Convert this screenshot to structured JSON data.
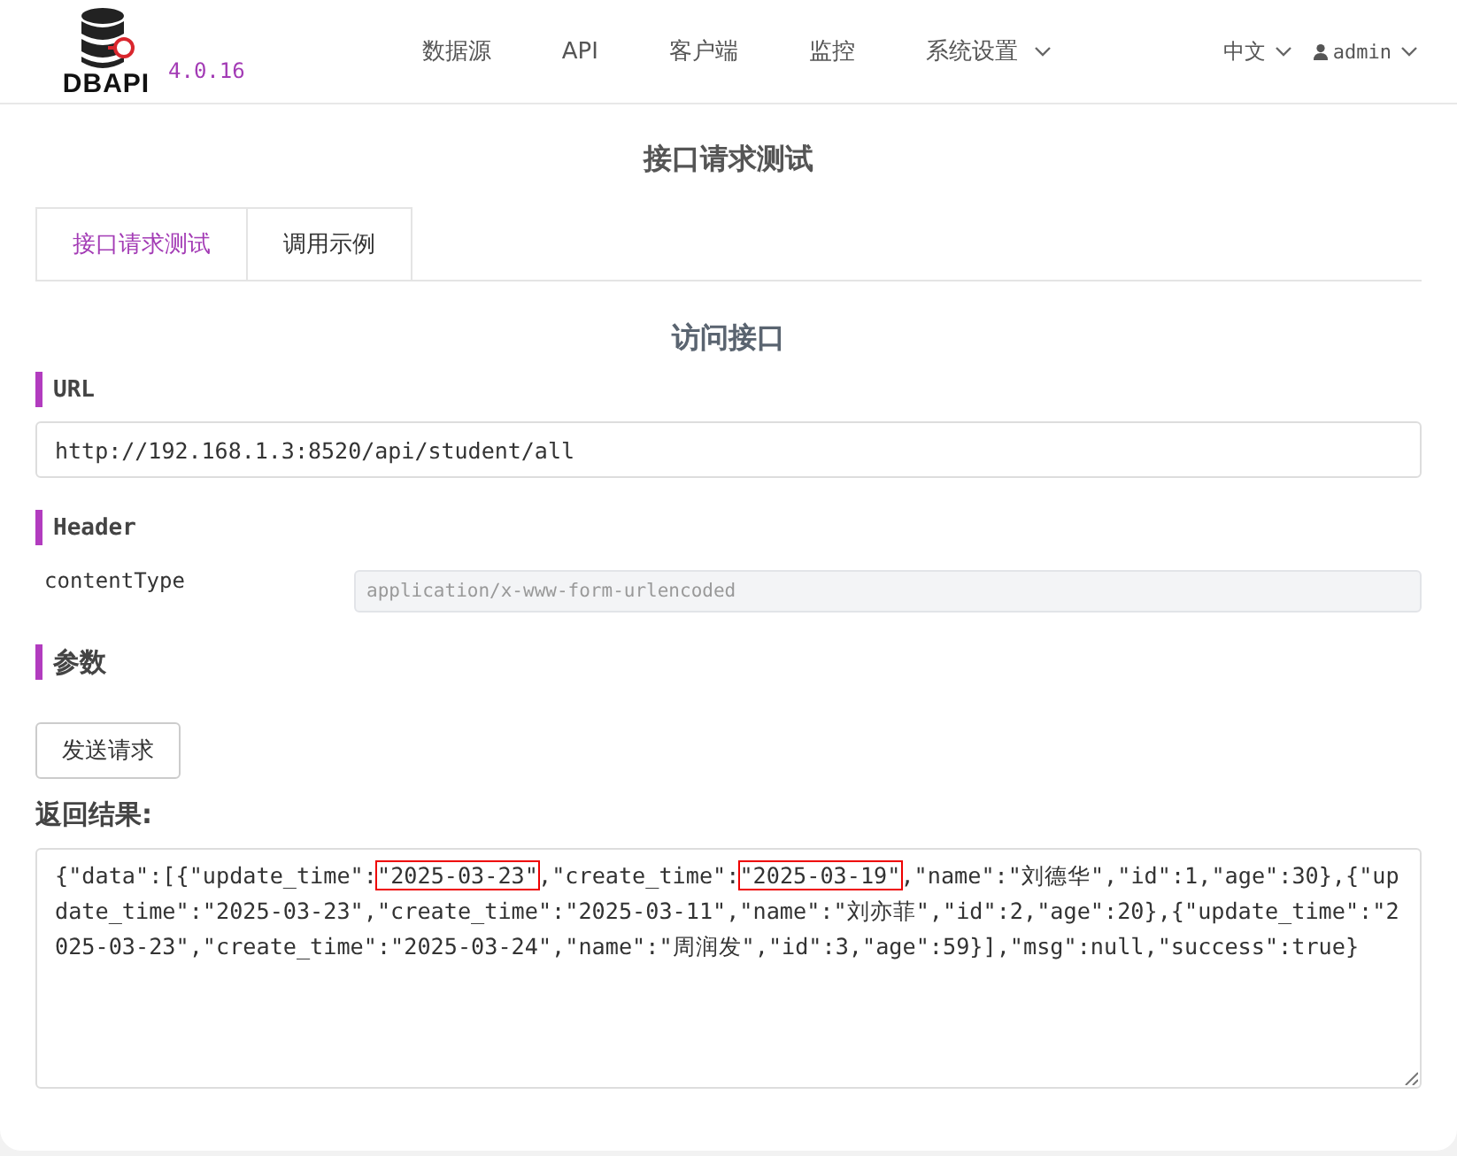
{
  "header": {
    "logo_text": "DBAPI",
    "version": "4.0.16",
    "nav": [
      {
        "label": "数据源",
        "dropdown": false
      },
      {
        "label": "API",
        "dropdown": false
      },
      {
        "label": "客户端",
        "dropdown": false
      },
      {
        "label": "监控",
        "dropdown": false
      },
      {
        "label": "系统设置",
        "dropdown": true
      }
    ],
    "language": "中文",
    "user": "admin"
  },
  "page_title": "接口请求测试",
  "tabs": [
    {
      "label": "接口请求测试",
      "selected": true
    },
    {
      "label": "调用示例",
      "selected": false
    }
  ],
  "section_title": "访问接口",
  "url": {
    "label": "URL",
    "value": "http://192.168.1.3:8520/api/student/all"
  },
  "header_section": {
    "label": "Header",
    "params": [
      {
        "name": "contentType",
        "placeholder": "application/x-www-form-urlencoded"
      }
    ]
  },
  "params_label": "参数",
  "send_button": "发送请求",
  "result": {
    "label": "返回结果:",
    "segments": [
      {
        "text": "{\"data\":[{\"update_time\":",
        "highlighted": false
      },
      {
        "text": "\"2025-03-23\"",
        "highlighted": true
      },
      {
        "text": ",\"create_time\":",
        "highlighted": false
      },
      {
        "text": "\"2025-03-19\"",
        "highlighted": true
      },
      {
        "text": ",\"name\":\"刘德华\",\"id\":1,\"age\":30},{\"update_time\":\"2025-03-23\",\"create_time\":\"2025-03-11\",\"name\":\"刘亦菲\",\"id\":2,\"age\":20},{\"update_time\":\"2025-03-23\",\"create_time\":\"2025-03-24\",\"name\":\"周润发\",\"id\":3,\"age\":59}],\"msg\":null,\"success\":true}",
        "highlighted": false
      }
    ]
  }
}
